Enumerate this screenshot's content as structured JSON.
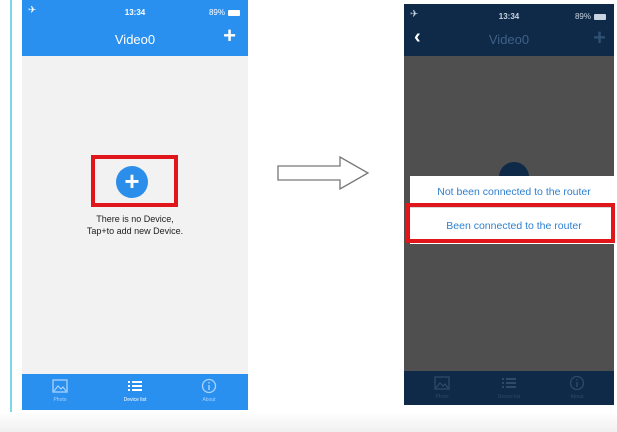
{
  "screen1": {
    "status": {
      "time": "13:34",
      "battery": "89%"
    },
    "title": "Video0",
    "empty_line1": "There is no Device,",
    "empty_line2": "Tap+to add new Device.",
    "tabs": [
      {
        "label": "Photo",
        "icon": "photo-icon"
      },
      {
        "label": "Device list",
        "icon": "list-icon"
      },
      {
        "label": "About",
        "icon": "info-icon"
      }
    ],
    "highlight_color": "#e0161b",
    "header_color": "#2a90f0"
  },
  "screen2": {
    "status": {
      "time": "13:34",
      "battery": "89%"
    },
    "title": "Video0",
    "menu": [
      "Not been connected to the router",
      "Been connected to the router"
    ],
    "tabs": [
      {
        "label": "Photo",
        "icon": "photo-icon"
      },
      {
        "label": "Device list",
        "icon": "list-icon"
      },
      {
        "label": "About",
        "icon": "info-icon"
      }
    ],
    "header_color": "#0e2a48"
  },
  "arrow_icon": "right-arrow-icon"
}
